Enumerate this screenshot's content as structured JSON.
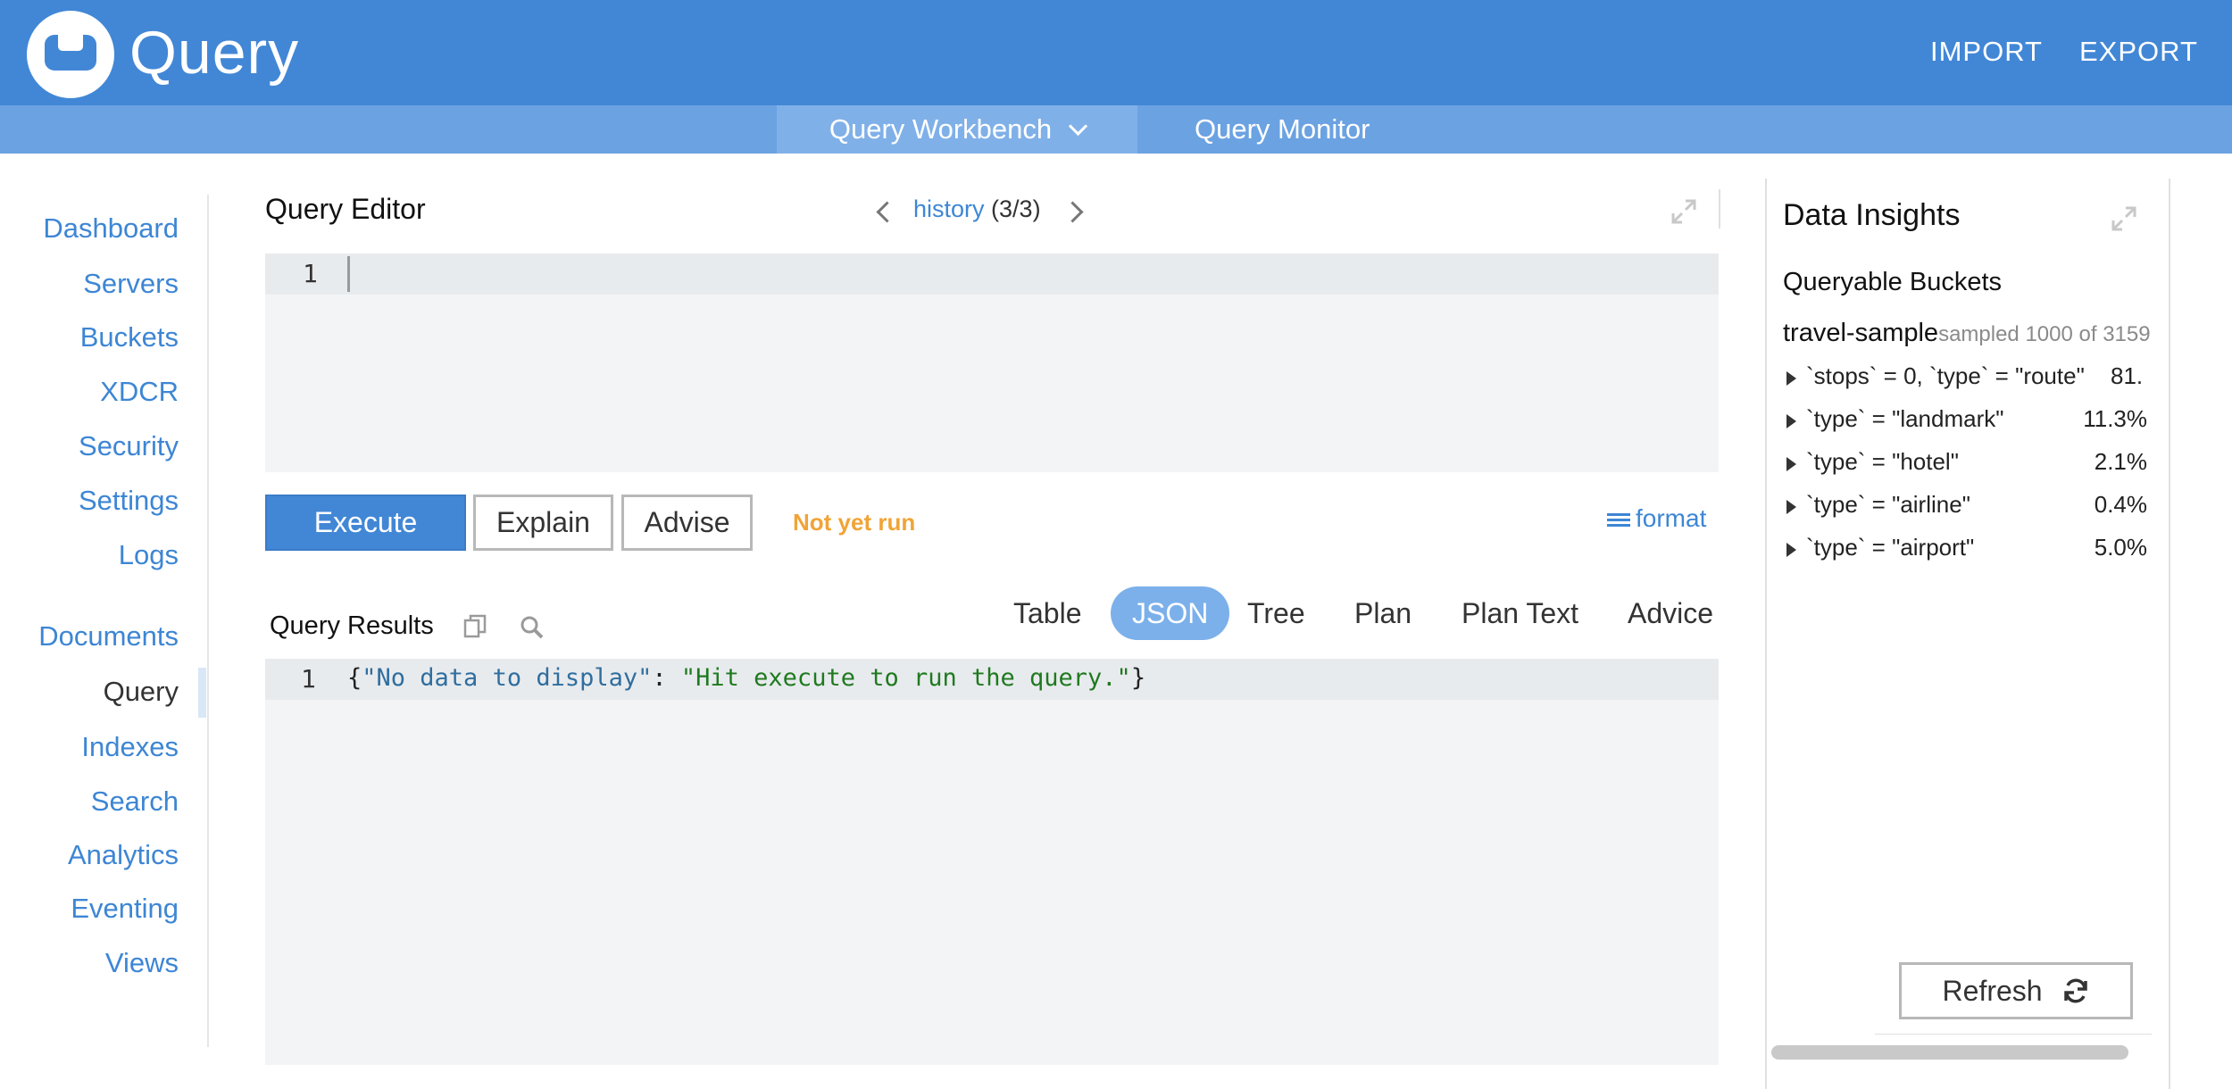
{
  "header": {
    "title": "Query",
    "import_label": "IMPORT",
    "export_label": "EXPORT"
  },
  "subnav": {
    "workbench": "Query Workbench",
    "monitor": "Query Monitor"
  },
  "sidebar": {
    "items": [
      {
        "label": "Dashboard"
      },
      {
        "label": "Servers"
      },
      {
        "label": "Buckets"
      },
      {
        "label": "XDCR"
      },
      {
        "label": "Security"
      },
      {
        "label": "Settings"
      },
      {
        "label": "Logs"
      },
      {
        "label": "Documents"
      },
      {
        "label": "Query"
      },
      {
        "label": "Indexes"
      },
      {
        "label": "Search"
      },
      {
        "label": "Analytics"
      },
      {
        "label": "Eventing"
      },
      {
        "label": "Views"
      }
    ]
  },
  "editor": {
    "title": "Query Editor",
    "history_link": "history",
    "history_count": "(3/3)",
    "line_number": "1"
  },
  "actions": {
    "execute": "Execute",
    "explain": "Explain",
    "advise": "Advise",
    "status": "Not yet run",
    "format": "format"
  },
  "results": {
    "title": "Query Results",
    "tabs": [
      "Table",
      "JSON",
      "Tree",
      "Plan",
      "Plan Text",
      "Advice"
    ],
    "active_tab": "JSON",
    "line_number": "1",
    "json_open": "{",
    "json_key": "\"No data to display\"",
    "json_sep": ": ",
    "json_value": "\"Hit execute to run the query.\"",
    "json_close": "}"
  },
  "insights": {
    "title": "Data Insights",
    "subtitle": "Queryable Buckets",
    "bucket_name": "travel-sample",
    "bucket_sampled": "sampled 1000 of 3159",
    "rows": [
      {
        "expr": "`stops` = 0, `type` = \"route\"",
        "pct": "81."
      },
      {
        "expr": "`type` = \"landmark\"",
        "pct": "11.3%"
      },
      {
        "expr": "`type` = \"hotel\"",
        "pct": "2.1%"
      },
      {
        "expr": "`type` = \"airline\"",
        "pct": "0.4%"
      },
      {
        "expr": "`type` = \"airport\"",
        "pct": "5.0%"
      }
    ],
    "refresh_label": "Refresh"
  },
  "colors": {
    "header_bg": "#4287d6",
    "subnav_bg": "#6ba2e2",
    "accent": "#3d86d4",
    "status": "#f0a437"
  }
}
